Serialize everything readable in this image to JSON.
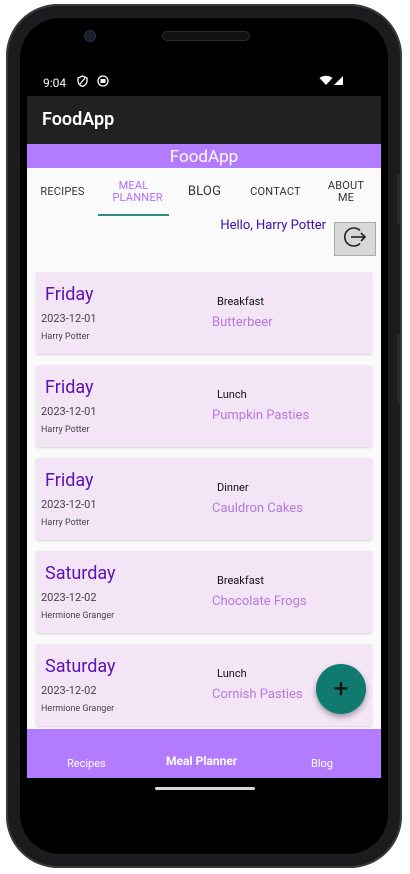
{
  "status_bar": {
    "time": "9:04"
  },
  "app_bar": {
    "title": "FoodApp"
  },
  "banner": {
    "title": "FoodApp"
  },
  "tabs": [
    {
      "label": "RECIPES"
    },
    {
      "label": "MEAL PLANNER",
      "active": true
    },
    {
      "label": "BLOG"
    },
    {
      "label": "CONTACT"
    },
    {
      "label": "ABOUT ME"
    }
  ],
  "greeting": "Hello, Harry Potter",
  "meals": [
    {
      "day": "Friday",
      "date": "2023-12-01",
      "person": "Harry Potter",
      "meal_type": "Breakfast",
      "meal_name": "Butterbeer"
    },
    {
      "day": "Friday",
      "date": "2023-12-01",
      "person": "Harry Potter",
      "meal_type": "Lunch",
      "meal_name": "Pumpkin Pasties"
    },
    {
      "day": "Friday",
      "date": "2023-12-01",
      "person": "Harry Potter",
      "meal_type": "Dinner",
      "meal_name": "Cauldron Cakes"
    },
    {
      "day": "Saturday",
      "date": "2023-12-02",
      "person": "Hermione Granger",
      "meal_type": "Breakfast",
      "meal_name": "Chocolate Frogs"
    },
    {
      "day": "Saturday",
      "date": "2023-12-02",
      "person": "Hermione Granger",
      "meal_type": "Lunch",
      "meal_name": "Cornish Pasties"
    }
  ],
  "fab": {
    "icon": "+"
  },
  "bottom_nav": [
    {
      "label": "Recipes"
    },
    {
      "label": "Meal Planner",
      "active": true
    },
    {
      "label": "Blog"
    }
  ],
  "colors": {
    "accent": "#b37bff",
    "fab": "#0f7a6d",
    "card": "#f3e5f6",
    "day_text": "#5b12b5",
    "meal_text": "#b37bdc"
  }
}
